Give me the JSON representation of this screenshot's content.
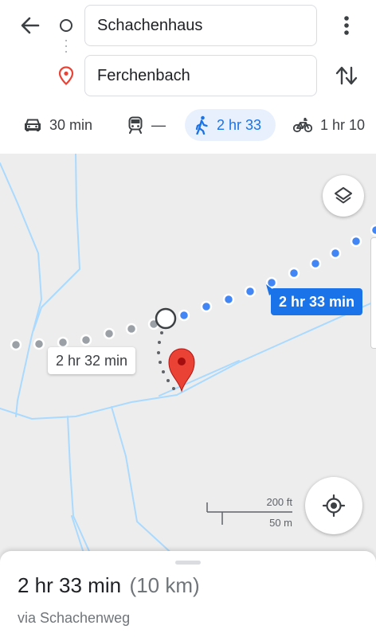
{
  "header": {
    "back_icon": "arrow-left-icon",
    "origin": "Schachenhaus",
    "destination": "Ferchenbach",
    "more_icon": "more-vert-icon",
    "swap_icon": "swap-vert-icon"
  },
  "modes": [
    {
      "icon": "car-icon",
      "label": "30 min",
      "selected": false
    },
    {
      "icon": "train-icon",
      "label": "—",
      "selected": false
    },
    {
      "icon": "walk-icon",
      "label": "2 hr 33",
      "selected": true
    },
    {
      "icon": "bike-icon",
      "label": "1 hr 10",
      "selected": false
    }
  ],
  "map": {
    "selected_route_label": "2 hr 33 min",
    "alternate_route_label": "2 hr 32 min",
    "scale_ft": "200 ft",
    "scale_m": "50 m",
    "layers_icon": "layers-icon",
    "locate_icon": "my-location-icon",
    "colors": {
      "background": "#ededed",
      "water": "#aadaff",
      "route_selected": "#4285f4",
      "route_alternate": "#9aa0a6",
      "destination_pin": "#ea4335",
      "label_selected_bg": "#1a73e8"
    }
  },
  "sheet": {
    "duration": "2 hr 33 min",
    "distance": "(10 km)",
    "via": "via Schachenweg"
  }
}
